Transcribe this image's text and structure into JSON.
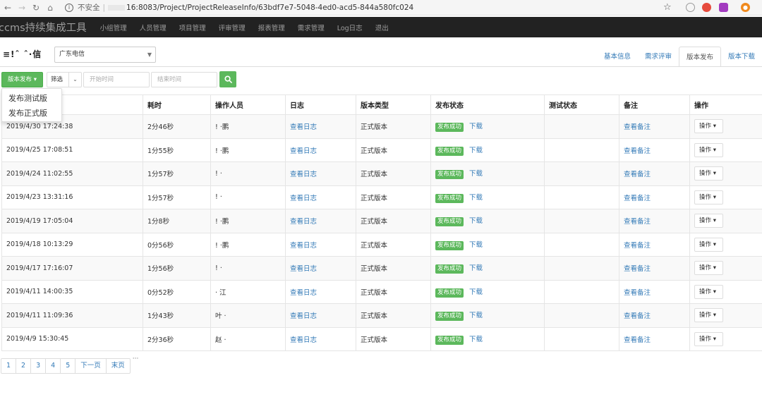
{
  "browser": {
    "address": "16:8083/Project/ProjectReleaseInfo/63bdf7e7-5048-4ed0-acd5-844a580fc024",
    "insecure_label": "不安全"
  },
  "navbar": {
    "brand": "ccms持续集成工具",
    "links": [
      "小组管理",
      "人员管理",
      "项目管理",
      "评审管理",
      "报表管理",
      "需求管理",
      "Log日志",
      "退出"
    ]
  },
  "project": {
    "title": "≡!ˆ  ˆ·信",
    "selected": "广东电信"
  },
  "tabs": [
    "基本信息",
    "需求评审",
    "版本发布",
    "版本下载"
  ],
  "tab_active": 2,
  "toolbar": {
    "release_button": "版本发布",
    "filter_label": "筛选",
    "start_placeholder": "开始时间",
    "end_placeholder": "结束时间"
  },
  "dropdown": {
    "items": [
      "发布测试版",
      "发布正式版"
    ]
  },
  "table": {
    "headers": [
      "",
      "耗时",
      "操作人员",
      "日志",
      "版本类型",
      "发布状态",
      "测试状态",
      "备注",
      "操作"
    ],
    "rows": [
      {
        "time": "2019/4/30 17:24:38",
        "duration": "2分46秒",
        "operator": "!  ·鹏",
        "log": "查看日志",
        "type": "正式版本",
        "status": "发布成功",
        "download": "下载",
        "remark": "查看备注",
        "op": "操作"
      },
      {
        "time": "2019/4/25 17:08:51",
        "duration": "1分55秒",
        "operator": "!  ·鹏",
        "log": "查看日志",
        "type": "正式版本",
        "status": "发布成功",
        "download": "下载",
        "remark": "查看备注",
        "op": "操作"
      },
      {
        "time": "2019/4/24 11:02:55",
        "duration": "1分57秒",
        "operator": "!  ·",
        "log": "查看日志",
        "type": "正式版本",
        "status": "发布成功",
        "download": "下载",
        "remark": "查看备注",
        "op": "操作"
      },
      {
        "time": "2019/4/23 13:31:16",
        "duration": "1分57秒",
        "operator": "!  ·",
        "log": "查看日志",
        "type": "正式版本",
        "status": "发布成功",
        "download": "下载",
        "remark": "查看备注",
        "op": "操作"
      },
      {
        "time": "2019/4/19 17:05:04",
        "duration": "1分8秒",
        "operator": "!  ·鹏",
        "log": "查看日志",
        "type": "正式版本",
        "status": "发布成功",
        "download": "下载",
        "remark": "查看备注",
        "op": "操作"
      },
      {
        "time": "2019/4/18 10:13:29",
        "duration": "0分56秒",
        "operator": "!  ·鹏",
        "log": "查看日志",
        "type": "正式版本",
        "status": "发布成功",
        "download": "下载",
        "remark": "查看备注",
        "op": "操作"
      },
      {
        "time": "2019/4/17 17:16:07",
        "duration": "1分56秒",
        "operator": "!  ·",
        "log": "查看日志",
        "type": "正式版本",
        "status": "发布成功",
        "download": "下载",
        "remark": "查看备注",
        "op": "操作"
      },
      {
        "time": "2019/4/11 14:00:35",
        "duration": "0分52秒",
        "operator": "  · 江",
        "log": "查看日志",
        "type": "正式版本",
        "status": "发布成功",
        "download": "下载",
        "remark": "查看备注",
        "op": "操作"
      },
      {
        "time": "2019/4/11 11:09:36",
        "duration": "1分43秒",
        "operator": "叶  ·",
        "log": "查看日志",
        "type": "正式版本",
        "status": "发布成功",
        "download": "下载",
        "remark": "查看备注",
        "op": "操作"
      },
      {
        "time": "2019/4/9 15:30:45",
        "duration": "2分36秒",
        "operator": "赵  ·",
        "log": "查看日志",
        "type": "正式版本",
        "status": "发布成功",
        "download": "下载",
        "remark": "查看备注",
        "op": "操作"
      }
    ]
  },
  "pagination": {
    "pages": [
      "1",
      "2",
      "3",
      "4",
      "5"
    ],
    "next": "下一页",
    "last": "末页",
    "ellipsis": "···"
  },
  "colors": {
    "navbar_bg": "#222222",
    "success_green": "#5cb85c",
    "link_blue": "#337ab7"
  }
}
